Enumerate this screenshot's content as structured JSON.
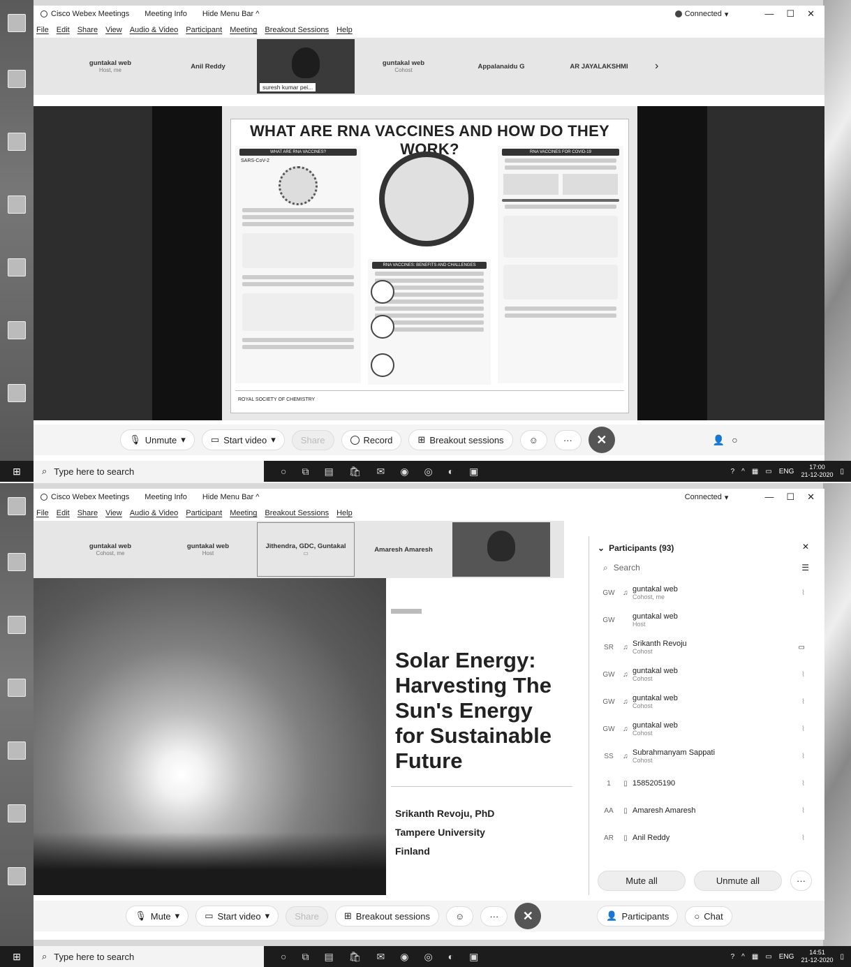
{
  "top": {
    "app_title": "Cisco Webex Meetings",
    "meeting_info": "Meeting Info",
    "hide_menu": "Hide Menu Bar ^",
    "status": "Connected",
    "menu": [
      "File",
      "Edit",
      "Share",
      "View",
      "Audio & Video",
      "Participant",
      "Meeting",
      "Breakout Sessions",
      "Help"
    ],
    "tiles": [
      {
        "name": "guntakal web",
        "role": "Host, me"
      },
      {
        "name": "Anil Reddy",
        "role": ""
      },
      {
        "name": "suresh kumar pei...",
        "role": "",
        "video": true
      },
      {
        "name": "guntakal web",
        "role": "Cohost"
      },
      {
        "name": "Appalanaidu G",
        "role": ""
      },
      {
        "name": "AR JAYALAKSHMI",
        "role": ""
      }
    ],
    "slide": {
      "title": "WHAT ARE RNA VACCINES AND HOW DO THEY WORK?",
      "left_band": "WHAT ARE RNA VACCINES?",
      "left_label": "SARS-CoV-2",
      "mid_band": "RNA VACCINES: BENEFITS AND CHALLENGES",
      "right_band": "RNA VACCINES FOR COVID-19",
      "footer": "ROYAL SOCIETY OF CHEMISTRY"
    },
    "controls": {
      "unmute": "Unmute",
      "start_video": "Start video",
      "share": "Share",
      "record": "Record",
      "breakout": "Breakout sessions"
    },
    "taskbar": {
      "search": "Type here to search",
      "lang": "ENG",
      "time": "17:00",
      "date": "21-12-2020"
    }
  },
  "bottom": {
    "app_title": "Cisco Webex Meetings",
    "meeting_info": "Meeting Info",
    "hide_menu": "Hide Menu Bar ^",
    "status": "Connected",
    "menu": [
      "File",
      "Edit",
      "Share",
      "View",
      "Audio & Video",
      "Participant",
      "Meeting",
      "Breakout Sessions",
      "Help"
    ],
    "tiles": [
      {
        "name": "guntakal web",
        "role": "Cohost, me"
      },
      {
        "name": "guntakal web",
        "role": "Host"
      },
      {
        "name": "Jithendra, GDC, Guntakal",
        "role": ""
      },
      {
        "name": "Amaresh Amaresh",
        "role": ""
      }
    ],
    "slide": {
      "title_lines": [
        "Solar Energy:",
        "Harvesting The",
        "Sun's Energy",
        "for Sustainable",
        "Future"
      ],
      "author": "Srikanth Revoju, PhD",
      "org": "Tampere University",
      "country": "Finland"
    },
    "participants": {
      "header": "Participants (93)",
      "search": "Search",
      "list": [
        {
          "av": "GW",
          "name": "guntakal web",
          "role": "Cohost, me"
        },
        {
          "av": "GW",
          "name": "guntakal web",
          "role": "Host"
        },
        {
          "av": "SR",
          "name": "Srikanth Revoju",
          "role": "Cohost"
        },
        {
          "av": "GW",
          "name": "guntakal web",
          "role": "Cohost"
        },
        {
          "av": "GW",
          "name": "guntakal web",
          "role": "Cohost"
        },
        {
          "av": "GW",
          "name": "guntakal web",
          "role": "Cohost"
        },
        {
          "av": "SS",
          "name": "Subrahmanyam Sappati",
          "role": "Cohost"
        },
        {
          "av": "1",
          "name": "1585205190",
          "role": ""
        },
        {
          "av": "AA",
          "name": "Amaresh Amaresh",
          "role": ""
        },
        {
          "av": "AR",
          "name": "Anil Reddy",
          "role": ""
        }
      ],
      "mute_all": "Mute all",
      "unmute_all": "Unmute all"
    },
    "controls": {
      "mute": "Mute",
      "start_video": "Start video",
      "share": "Share",
      "breakout": "Breakout sessions",
      "participants": "Participants",
      "chat": "Chat"
    },
    "taskbar": {
      "search": "Type here to search",
      "lang": "ENG",
      "time": "14:51",
      "date": "21-12-2020"
    }
  }
}
